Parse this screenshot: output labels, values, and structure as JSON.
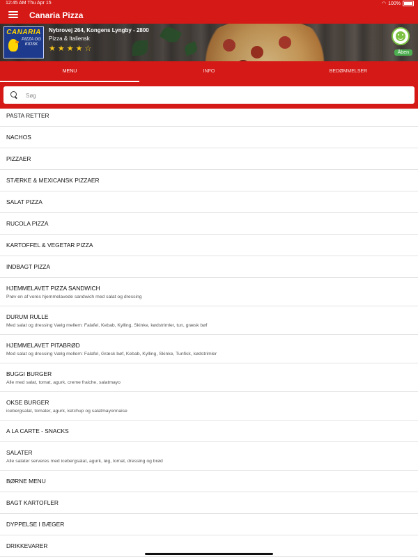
{
  "status_bar": {
    "time": "12:45 AM",
    "date": "Thu Apr 15",
    "battery": "100%"
  },
  "app_bar": {
    "title": "Canaria Pizza",
    "menu_icon": "hamburger-menu-icon"
  },
  "restaurant": {
    "logo_name": "CANARIA",
    "logo_sub": "PIZZA OG KIOSK",
    "address": "Nybrovej 264, Kongens Lyngby - 2800",
    "cuisine": "Pizza & Italiensk",
    "rating": 4.5,
    "status": "Åben"
  },
  "tabs": [
    {
      "label": "MENU",
      "active": true
    },
    {
      "label": "INFO",
      "active": false
    },
    {
      "label": "BEDØMMELSER",
      "active": false
    }
  ],
  "search": {
    "placeholder": "Søg",
    "value": ""
  },
  "colors": {
    "primary": "#d41916",
    "accent_star": "#f5c518",
    "open_green": "#4caf50"
  },
  "categories": [
    {
      "title": "PASTA RETTER",
      "desc": ""
    },
    {
      "title": "NACHOS",
      "desc": ""
    },
    {
      "title": "PIZZAER",
      "desc": ""
    },
    {
      "title": "STÆRKE & MEXICANSK PIZZAER",
      "desc": ""
    },
    {
      "title": "SALAT PIZZA",
      "desc": ""
    },
    {
      "title": "RUCOLA PIZZA",
      "desc": ""
    },
    {
      "title": "KARTOFFEL & VEGETAR PIZZA",
      "desc": ""
    },
    {
      "title": "INDBAGT PIZZA",
      "desc": ""
    },
    {
      "title": "HJEMMELAVET PIZZA SANDWICH",
      "desc": "Prøv en af vores hjemmelavede sandwich med salat og dressing"
    },
    {
      "title": "DURUM RULLE",
      "desc": "Med salat og dressing  Vælg mellem: Falafel, Kebab, Kylling, Skinke, kødstrimler, tun, græsk bøf"
    },
    {
      "title": "HJEMMELAVET PITABRØD",
      "desc": "Med salat og dressing Vælg mellem: Falafel, Græsk bøf, Kebab, Kylling, Skinke, Tunfisk, kødstrimler"
    },
    {
      "title": "BUGGI BURGER",
      "desc": "Alle med salat, tomat, agurk, creme fraiche, salatmayo"
    },
    {
      "title": "OKSE BURGER",
      "desc": "icebergsalat, tomater, agurk, ketchup og salatmayonnaise"
    },
    {
      "title": "A LA CARTE - SNACKS",
      "desc": ""
    },
    {
      "title": "SALATER",
      "desc": "Alle salater serveres med icebergsalat, agurk, løg, tomat, dressing og brød"
    },
    {
      "title": "BØRNE MENU",
      "desc": ""
    },
    {
      "title": "BAGT KARTOFLER",
      "desc": ""
    },
    {
      "title": "DYPPELSE I BÆGER",
      "desc": ""
    },
    {
      "title": "DRIKKEVARER",
      "desc": ""
    }
  ]
}
